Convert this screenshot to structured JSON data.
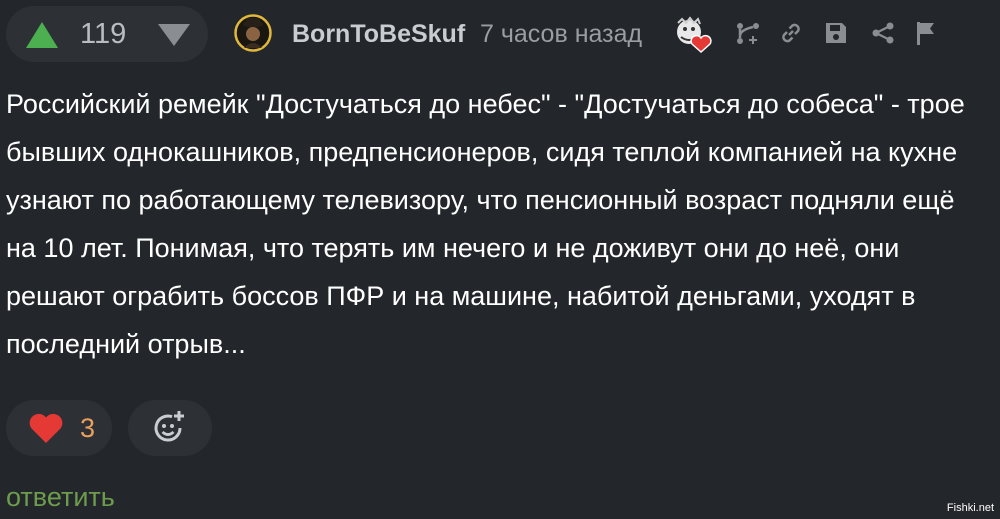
{
  "rating": {
    "value": "119",
    "up_icon": "triangle-up-icon",
    "down_icon": "triangle-down-icon",
    "up_color": "#4caf50",
    "down_color": "#8a8d92"
  },
  "author": {
    "username": "BornToBeSkuf",
    "avatar_icon": "user-avatar",
    "time_ago": "7 часов назад",
    "badge_icon": "award-heart-icon"
  },
  "actions": [
    {
      "icon": "branch-icon"
    },
    {
      "icon": "link-icon"
    },
    {
      "icon": "save-icon"
    },
    {
      "icon": "share-icon"
    },
    {
      "icon": "flag-icon"
    }
  ],
  "comment": {
    "text": "Российский ремейк \"Достучаться до небес\" - \"Достучаться до собеса\" - трое бывших однокашников, предпенсионеров, сидя теплой компанией на кухне узнают по работающему телевизору, что пенсионный возраст подняли ещё на 10 лет. Понимая, что терять им нечего и не доживут они до неё, они решают ограбить боссов ПФР и на машине, набитой деньгами, уходят в последний отрыв..."
  },
  "reactions": {
    "like_count": "3",
    "like_icon": "heart-icon",
    "add_reaction_icon": "add-reaction-icon"
  },
  "reply_label": "ответить",
  "watermark": "Fishki.net",
  "colors": {
    "background": "#23262a",
    "pill": "#2d3035",
    "accent_green": "#4caf50",
    "like_red": "#e53935",
    "reply_green": "#6c9c4c",
    "count_orange": "#e8a05c"
  }
}
